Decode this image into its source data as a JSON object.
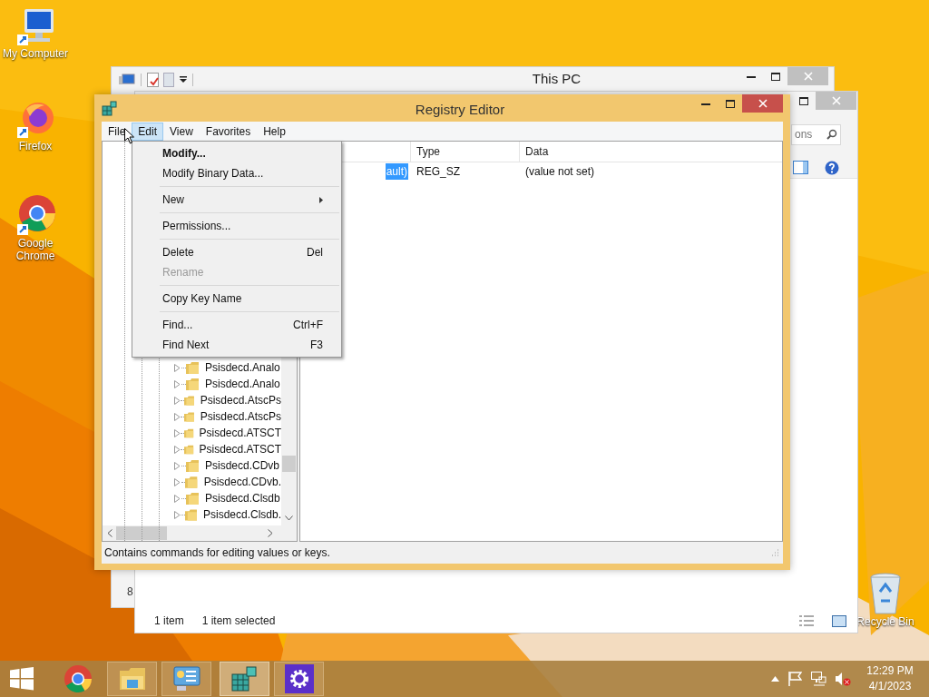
{
  "desktop_icons": [
    {
      "label": "My Computer",
      "kind": "computer"
    },
    {
      "label": "Firefox",
      "kind": "firefox"
    },
    {
      "label": "Google Chrome",
      "kind": "chrome"
    },
    {
      "label": "Recycle Bin",
      "kind": "recycle"
    }
  ],
  "this_pc_window": {
    "title": "This PC",
    "partial_text": "8"
  },
  "explorer_window": {
    "search_placeholder": "ons",
    "status_items": [
      "1 item",
      "1 item selected"
    ]
  },
  "registry_editor": {
    "title": "Registry Editor",
    "menu": [
      {
        "label": "File",
        "selected": false
      },
      {
        "label": "Edit",
        "selected": true
      },
      {
        "label": "View",
        "selected": false
      },
      {
        "label": "Favorites",
        "selected": false
      },
      {
        "label": "Help",
        "selected": false
      }
    ],
    "tree_items": [
      {
        "label": "Psisdecd.Analo",
        "expanded": false
      },
      {
        "label": "Psisdecd.Analo",
        "expanded": false
      },
      {
        "label": "Psisdecd.AtscPs",
        "expanded": false
      },
      {
        "label": "Psisdecd.AtscPs",
        "expanded": false
      },
      {
        "label": "Psisdecd.ATSCT",
        "expanded": false
      },
      {
        "label": "Psisdecd.ATSCT",
        "expanded": false
      },
      {
        "label": "Psisdecd.CDvb",
        "expanded": false
      },
      {
        "label": "Psisdecd.CDvb.",
        "expanded": false
      },
      {
        "label": "Psisdecd.Clsdb",
        "expanded": false
      },
      {
        "label": "Psisdecd.Clsdb.",
        "expanded": false
      }
    ],
    "columns": [
      "Type",
      "Data"
    ],
    "values": [
      {
        "name": "ault)",
        "type": "REG_SZ",
        "data": "(value not set)",
        "selected": true
      }
    ],
    "status_bar": "Contains commands for editing values or keys."
  },
  "edit_menu": {
    "sections": [
      {
        "items": [
          {
            "label": "Modify...",
            "default": true,
            "disabled": false
          },
          {
            "label": "Modify Binary Data...",
            "default": false,
            "disabled": false
          }
        ]
      },
      {
        "items": [
          {
            "label": "New",
            "default": false,
            "disabled": false,
            "submenu": true
          }
        ]
      },
      {
        "items": [
          {
            "label": "Permissions...",
            "default": false,
            "disabled": false
          }
        ]
      },
      {
        "items": [
          {
            "label": "Delete",
            "shortcut": "Del",
            "default": false,
            "disabled": false
          },
          {
            "label": "Rename",
            "default": false,
            "disabled": true
          }
        ]
      },
      {
        "items": [
          {
            "label": "Copy Key Name",
            "default": false,
            "disabled": false
          }
        ]
      },
      {
        "items": [
          {
            "label": "Find...",
            "shortcut": "Ctrl+F",
            "default": false,
            "disabled": false
          },
          {
            "label": "Find Next",
            "shortcut": "F3",
            "default": false,
            "disabled": false
          }
        ]
      }
    ]
  },
  "taskbar": {
    "apps": [
      {
        "kind": "chrome",
        "running": false,
        "active": false
      },
      {
        "kind": "explorer",
        "running": true,
        "active": false
      },
      {
        "kind": "control",
        "running": true,
        "active": false
      },
      {
        "kind": "regedit",
        "running": true,
        "active": true
      },
      {
        "kind": "settings",
        "running": true,
        "active": false
      }
    ],
    "volume_muted": true,
    "time": "12:29 PM",
    "date": "4/1/2023"
  }
}
